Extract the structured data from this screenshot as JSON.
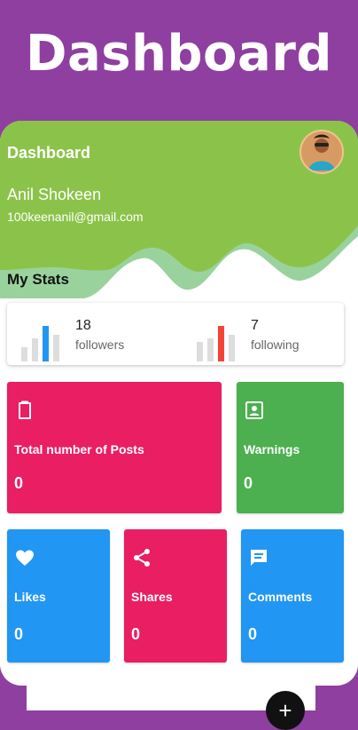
{
  "app": {
    "hero_title": "Dashboard"
  },
  "header": {
    "card_title": "Dashboard",
    "user_name": "Anil Shokeen",
    "user_email": "100keenanil@gmail.com"
  },
  "stats": {
    "section_title": "My Stats",
    "followers": {
      "count": "18",
      "label": "followers",
      "accent": "#2196f3"
    },
    "following": {
      "count": "7",
      "label": "following",
      "accent": "#f44336"
    }
  },
  "tiles": {
    "posts": {
      "label": "Total number of Posts",
      "value": "0",
      "icon": "clipboard-icon",
      "color": "#e91e63"
    },
    "warnings": {
      "label": "Warnings",
      "value": "0",
      "icon": "account-box-icon",
      "color": "#4caf50"
    },
    "likes": {
      "label": "Likes",
      "value": "0",
      "icon": "heart-icon",
      "color": "#2196f3"
    },
    "shares": {
      "label": "Shares",
      "value": "0",
      "icon": "share-icon",
      "color": "#e91e63"
    },
    "comments": {
      "label": "Comments",
      "value": "0",
      "icon": "comment-icon",
      "color": "#2196f3"
    }
  },
  "colors": {
    "background": "#8e3fa0",
    "header_green": "#8bc34a"
  }
}
